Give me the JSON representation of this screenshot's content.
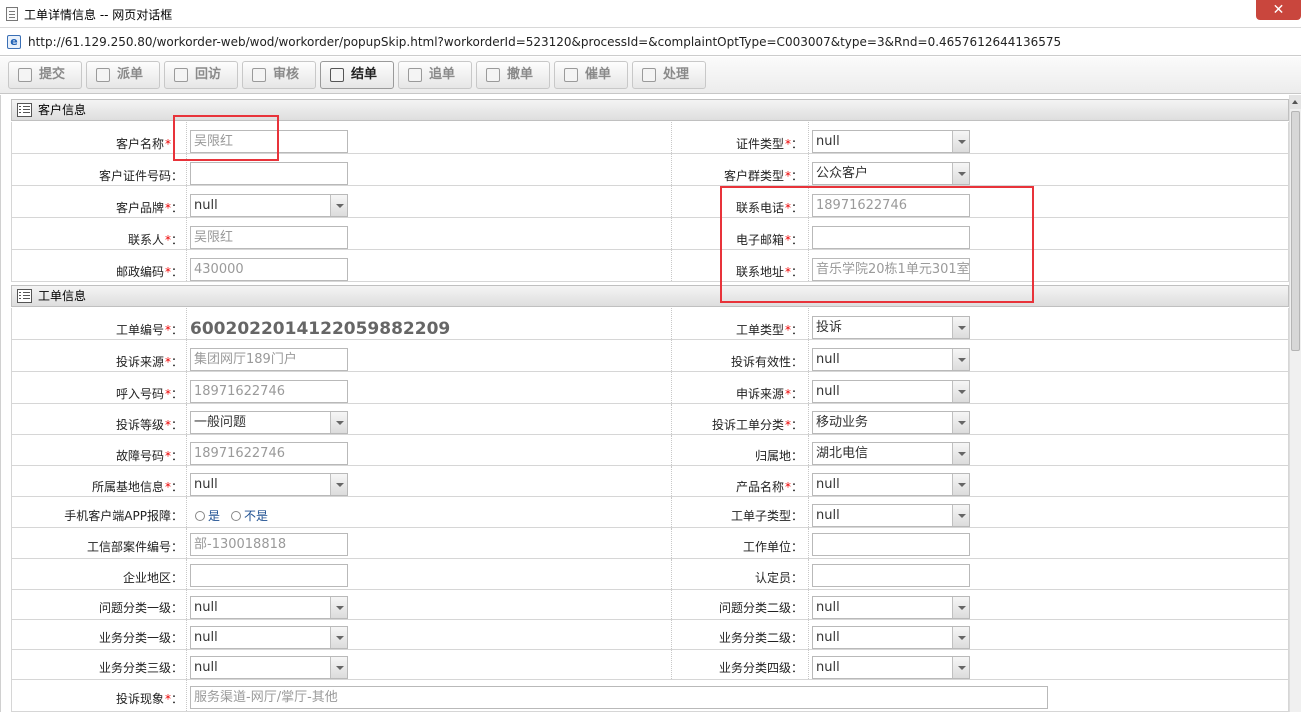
{
  "window": {
    "title": "工单详情信息 -- 网页对话框",
    "close_label": "✕"
  },
  "address": {
    "url": "http://61.129.250.80/workorder-web/wod/workorder/popupSkip.html?workorderId=523120&processId=&complaintOptType=C003007&type=3&Rnd=0.4657612644136575"
  },
  "toolbar": {
    "buttons": [
      {
        "label": "提交",
        "icon": "submit-icon"
      },
      {
        "label": "派单",
        "icon": "dispatch-icon"
      },
      {
        "label": "回访",
        "icon": "callback-icon"
      },
      {
        "label": "审核",
        "icon": "review-icon"
      },
      {
        "label": "结单",
        "icon": "close-order-icon"
      },
      {
        "label": "追单",
        "icon": "follow-icon"
      },
      {
        "label": "撤单",
        "icon": "cancel-icon"
      },
      {
        "label": "催单",
        "icon": "urge-icon"
      },
      {
        "label": "处理",
        "icon": "process-icon"
      }
    ]
  },
  "customer": {
    "title": "客户信息",
    "name": {
      "label": "客户名称",
      "value": "吴限红"
    },
    "id_type": {
      "label": "证件类型",
      "value": "null"
    },
    "id_number": {
      "label": "客户证件号码",
      "value": ""
    },
    "group_type": {
      "label": "客户群类型",
      "value": "公众客户"
    },
    "brand": {
      "label": "客户品牌",
      "value": "null"
    },
    "phone": {
      "label": "联系电话",
      "value": "18971622746"
    },
    "contact": {
      "label": "联系人",
      "value": "吴限红"
    },
    "email": {
      "label": "电子邮箱",
      "value": ""
    },
    "postcode": {
      "label": "邮政编码",
      "value": "430000"
    },
    "address": {
      "label": "联系地址",
      "value": "音乐学院20栋1单元301室"
    }
  },
  "order": {
    "title": "工单信息",
    "number": {
      "label": "工单编号",
      "value": "6002022014122059882209"
    },
    "type": {
      "label": "工单类型",
      "value": "投诉"
    },
    "source": {
      "label": "投诉来源",
      "value": "集团网厅189门户"
    },
    "validity": {
      "label": "投诉有效性",
      "value": "null"
    },
    "call_number": {
      "label": "呼入号码",
      "value": "18971622746"
    },
    "appeal_source": {
      "label": "申诉来源",
      "value": "null"
    },
    "level": {
      "label": "投诉等级",
      "value": "一般问题"
    },
    "category": {
      "label": "投诉工单分类",
      "value": "移动业务"
    },
    "fault_number": {
      "label": "故障号码",
      "value": "18971622746"
    },
    "home": {
      "label": "归属地",
      "value": "湖北电信"
    },
    "base_info": {
      "label": "所属基地信息",
      "value": "null"
    },
    "product": {
      "label": "产品名称",
      "value": "null"
    },
    "app_report": {
      "label": "手机客户端APP报障",
      "yes": "是",
      "no": "不是"
    },
    "subtype": {
      "label": "工单子类型",
      "value": "null"
    },
    "miit_number": {
      "label": "工信部案件编号",
      "value": "部-130018818"
    },
    "work_unit": {
      "label": "工作单位",
      "value": ""
    },
    "region": {
      "label": "企业地区",
      "value": ""
    },
    "assessor": {
      "label": "认定员",
      "value": ""
    },
    "cat1": {
      "label": "问题分类一级",
      "value": "null"
    },
    "cat2": {
      "label": "问题分类二级",
      "value": "null"
    },
    "biz1": {
      "label": "业务分类一级",
      "value": "null"
    },
    "biz2": {
      "label": "业务分类二级",
      "value": "null"
    },
    "biz3": {
      "label": "业务分类三级",
      "value": "null"
    },
    "biz4": {
      "label": "业务分类四级",
      "value": "null"
    },
    "phenomenon": {
      "label": "投诉现象",
      "value": "服务渠道-网厅/掌厅-其他"
    }
  },
  "required_mark": "*",
  "colon": "："
}
